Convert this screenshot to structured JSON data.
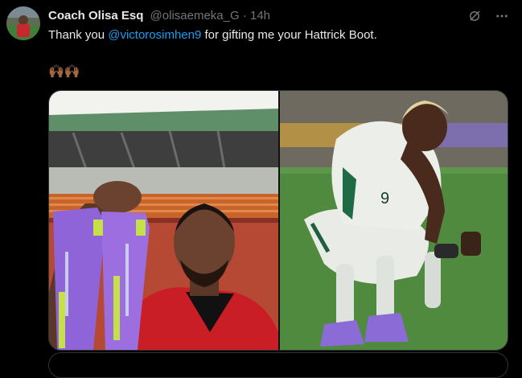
{
  "tweet": {
    "author_name": "Coach Olisa Esq",
    "handle": "@olisaemeka_G",
    "separator": "·",
    "time": "14h",
    "text_before": "Thank you ",
    "mention": "@victorosimhen9",
    "text_after": " for gifting me your Hattrick Boot.",
    "emoji": "🙌🏾🙌🏾"
  },
  "icons": {
    "grok": "grok-icon",
    "more": "more-icon"
  },
  "media": {
    "left_alt": "selfie-holding-boots-photo",
    "right_alt": "player-squatting-photo"
  },
  "colors": {
    "accent": "#1d9bf0",
    "text": "#e7e9ea",
    "secondary": "#71767b",
    "background": "#000000"
  }
}
